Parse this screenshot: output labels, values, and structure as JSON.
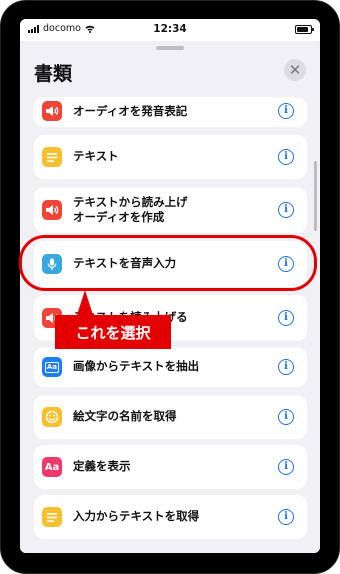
{
  "statusbar": {
    "carrier": "docomo",
    "time": "12:34"
  },
  "sheet": {
    "title": "書類",
    "close_symbol": "✕"
  },
  "items": [
    {
      "label": "オーディオを発音表記",
      "icon": "speaker-wave-icon",
      "icon_color": "#f04437"
    },
    {
      "label": "テキスト",
      "icon": "note-lines-icon",
      "icon_color": "#f6c02e"
    },
    {
      "label": "テキストから読み上げ\nオーディオを作成",
      "icon": "speaker-wave-icon",
      "icon_color": "#f04437"
    },
    {
      "label": "テキストを音声入力",
      "icon": "microphone-icon",
      "icon_color": "#39a8e0"
    },
    {
      "label": "テキストを読み上げる",
      "icon": "speaker-wave-icon",
      "icon_color": "#f04437"
    },
    {
      "label": "画像からテキストを抽出",
      "icon": "image-text-icon",
      "icon_color": "#1c7ef0",
      "icon_text": "Aa"
    },
    {
      "label": "絵文字の名前を取得",
      "icon": "smiley-icon",
      "icon_color": "#f6c02e"
    },
    {
      "label": "定義を表示",
      "icon": "dictionary-icon",
      "icon_color": "#ee3a6a",
      "icon_text": "Aa"
    },
    {
      "label": "入力からテキストを取得",
      "icon": "note-lines-icon",
      "icon_color": "#f6c02e"
    }
  ],
  "info_symbol": "i",
  "annotation": {
    "callout_text": "これを選択",
    "color": "#e30000"
  }
}
